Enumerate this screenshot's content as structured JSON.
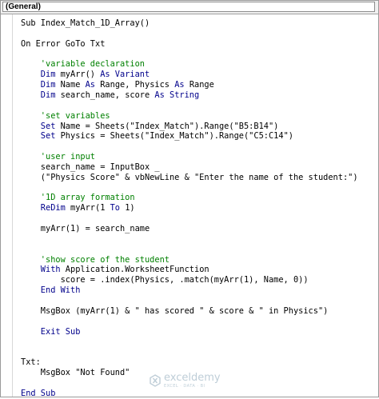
{
  "toolbar": {
    "object_combo": "(General)"
  },
  "code_lines": [
    [
      {
        "t": "Sub Index_Match_1D_Array()",
        "c": ""
      }
    ],
    [],
    [
      {
        "t": "On Error GoTo Txt",
        "c": ""
      }
    ],
    [],
    [
      {
        "t": "    'variable declaration",
        "c": "cm"
      }
    ],
    [
      {
        "t": "    Dim",
        "c": "kw"
      },
      {
        "t": " myArr() ",
        "c": ""
      },
      {
        "t": "As Variant",
        "c": "kw"
      }
    ],
    [
      {
        "t": "    Dim",
        "c": "kw"
      },
      {
        "t": " Name ",
        "c": ""
      },
      {
        "t": "As",
        "c": "kw"
      },
      {
        "t": " Range, Physics ",
        "c": ""
      },
      {
        "t": "As",
        "c": "kw"
      },
      {
        "t": " Range",
        "c": ""
      }
    ],
    [
      {
        "t": "    Dim",
        "c": "kw"
      },
      {
        "t": " search_name, score ",
        "c": ""
      },
      {
        "t": "As String",
        "c": "kw"
      }
    ],
    [],
    [
      {
        "t": "    'set variables",
        "c": "cm"
      }
    ],
    [
      {
        "t": "    Set",
        "c": "kw"
      },
      {
        "t": " Name = Sheets(\"Index_Match\").Range(\"B5:B14\")",
        "c": ""
      }
    ],
    [
      {
        "t": "    Set",
        "c": "kw"
      },
      {
        "t": " Physics = Sheets(\"Index_Match\").Range(\"C5:C14\")",
        "c": ""
      }
    ],
    [],
    [
      {
        "t": "    'user input",
        "c": "cm"
      }
    ],
    [
      {
        "t": "    search_name = InputBox _",
        "c": ""
      }
    ],
    [
      {
        "t": "    (\"Physics Score\" & vbNewLine & \"Enter the name of the student:\")",
        "c": ""
      }
    ],
    [],
    [
      {
        "t": "    '1D array formation",
        "c": "cm"
      }
    ],
    [
      {
        "t": "    ReDim",
        "c": "kw"
      },
      {
        "t": " myArr(1 ",
        "c": ""
      },
      {
        "t": "To",
        "c": "kw"
      },
      {
        "t": " 1)",
        "c": ""
      }
    ],
    [],
    [
      {
        "t": "    myArr(1) = search_name",
        "c": ""
      }
    ],
    [],
    [],
    [
      {
        "t": "    'show score of the student",
        "c": "cm"
      }
    ],
    [
      {
        "t": "    With",
        "c": "kw"
      },
      {
        "t": " Application.WorksheetFunction",
        "c": ""
      }
    ],
    [
      {
        "t": "        score = .index(Physics, .match(myArr(1), Name, 0))",
        "c": ""
      }
    ],
    [
      {
        "t": "    End With",
        "c": "kw"
      }
    ],
    [],
    [
      {
        "t": "    MsgBox (myArr(1) & \" has scored \" & score & \" in Physics\")",
        "c": ""
      }
    ],
    [],
    [
      {
        "t": "    Exit Sub",
        "c": "kw"
      }
    ],
    [],
    [],
    [
      {
        "t": "Txt:",
        "c": ""
      }
    ],
    [
      {
        "t": "    MsgBox \"Not Found\"",
        "c": ""
      }
    ],
    [],
    [
      {
        "t": "End Sub",
        "c": "kw"
      }
    ]
  ],
  "watermark": {
    "name": "exceldemy",
    "tagline": "EXCEL · DATA · BI",
    "color": "#8aa6b8"
  },
  "colors": {
    "keyword": "#00008b",
    "comment": "#008000",
    "text": "#000000"
  }
}
